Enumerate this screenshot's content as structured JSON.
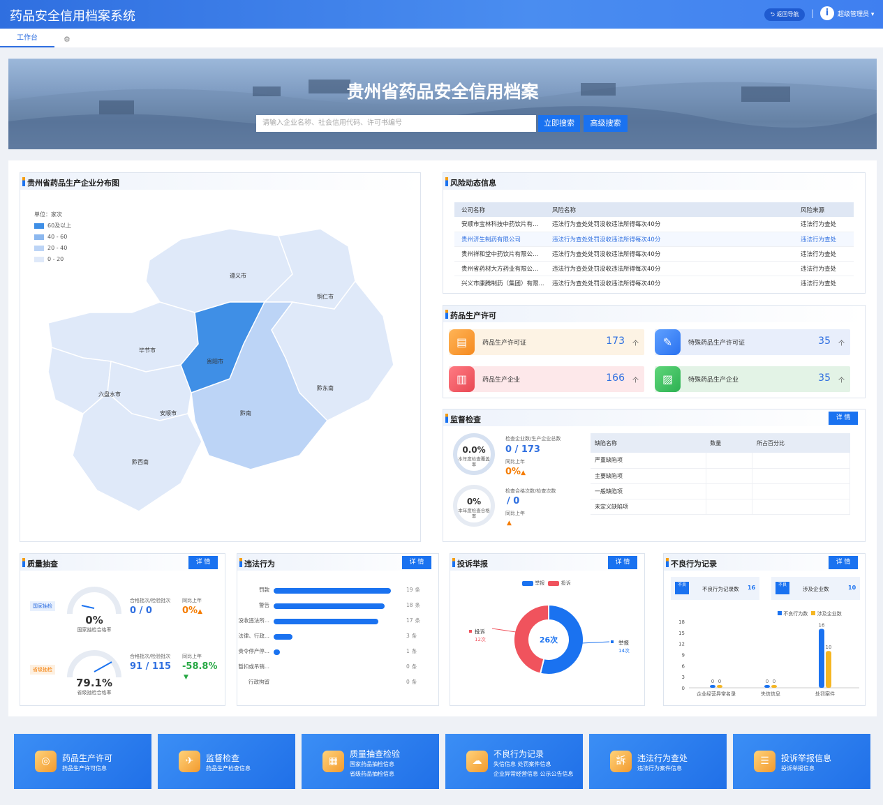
{
  "header": {
    "title": "药品安全信用档案系统",
    "back_label": "返回导航",
    "user_label": "超级管理员",
    "avatar_glyph": "i"
  },
  "tabs": {
    "workbench": "工作台"
  },
  "banner": {
    "title": "贵州省药品安全信用档案",
    "placeholder": "请输入企业名称、社会信用代码、许可书编号",
    "search_btn": "立即搜索",
    "adv_btn": "高级搜索"
  },
  "map": {
    "title": "贵州省药品生产企业分布图",
    "unit": "单位：家次",
    "legend": [
      "60及以上",
      "40 - 60",
      "20 - 40",
      "0 - 20"
    ],
    "legend_colors": [
      "#3f8fe6",
      "#8cb8ef",
      "#bcd4f6",
      "#dfe9f9"
    ],
    "cities": [
      "遵义市",
      "铜仁市",
      "毕节市",
      "贵阳市",
      "黔东南",
      "六盘水市",
      "安顺市",
      "黔南",
      "黔西南"
    ]
  },
  "risk": {
    "title": "风险动态信息",
    "cols": [
      "公司名称",
      "风险名称",
      "风险来源"
    ],
    "rows": [
      [
        "安顺市宝林科技中药饮片有...",
        "违法行为查处处罚没收违法所得每次40分",
        "违法行为查处"
      ],
      [
        "贵州济生制药有限公司",
        "违法行为查处处罚没收违法所得每次40分",
        "违法行为查处"
      ],
      [
        "贵州祥和堂中药饮片有限公...",
        "违法行为查处处罚没收违法所得每次40分",
        "违法行为查处"
      ],
      [
        "贵州省药材大方药业有限公...",
        "违法行为查处处罚没收违法所得每次40分",
        "违法行为查处"
      ],
      [
        "兴义市康腾制药（集团）有限...",
        "违法行为查处处罚没收违法所得每次40分",
        "违法行为查处"
      ]
    ]
  },
  "license": {
    "title": "药品生产许可",
    "unit": "个",
    "cards": [
      {
        "label": "药品生产许可证",
        "value": "173"
      },
      {
        "label": "特殊药品生产许可证",
        "value": "35"
      },
      {
        "label": "药品生产企业",
        "value": "166"
      },
      {
        "label": "特殊药品生产企业",
        "value": "35"
      }
    ]
  },
  "inspect": {
    "title": "监督检查",
    "detail": "详 情",
    "ring1_value": "0.0%",
    "ring1_sub": "本年度检查覆盖率",
    "label1": "检查企业数/生产企业总数",
    "value1": "0 / 173",
    "yoy": "同比上年",
    "yoy1": "0%",
    "ring2_value": "0%",
    "ring2_sub": "本年度检查合格率",
    "label2": "检查合格次数/检查次数",
    "value2": "/ 0",
    "yoy2": "",
    "cols": [
      "缺陷名称",
      "数量",
      "所占百分比"
    ],
    "rows": [
      "严重缺陷项",
      "主要缺陷项",
      "一般缺陷项",
      "未定义缺陷项"
    ]
  },
  "quality": {
    "title": "质量抽查",
    "detail": "详 情",
    "national": {
      "tag": "国家抽检",
      "pct": "0%",
      "caption": "国家抽检合格率",
      "label": "合格批次/检验批次",
      "value": "0 / 0",
      "yoy_label": "同比上年",
      "yoy": "0%"
    },
    "province": {
      "tag": "省级抽检",
      "pct": "79.1%",
      "caption": "省级抽检合格率",
      "label": "合格批次/检验批次",
      "value": "91 / 115",
      "yoy_label": "同比上年",
      "yoy": "-58.8%"
    }
  },
  "illegal": {
    "title": "违法行为",
    "detail": "详 情",
    "unit": "条",
    "chart_data": {
      "type": "bar",
      "categories": [
        "罚款",
        "警告",
        "没收违法所...",
        "法律、行政...",
        "责令停产停...",
        "暂扣或吊销...",
        "行政拘留"
      ],
      "values": [
        19,
        18,
        17,
        3,
        1,
        0,
        0
      ],
      "xlim": [
        0,
        19
      ]
    }
  },
  "complaint": {
    "title": "投诉举报",
    "detail": "详 情",
    "center": "26次",
    "chart_data": {
      "type": "pie",
      "series": [
        {
          "name": "举报",
          "value": 14,
          "color": "#1a72f0"
        },
        {
          "name": "投诉",
          "value": 12,
          "color": "#f0535d"
        }
      ],
      "labels": [
        "举报",
        "14次",
        "投诉",
        "12次"
      ]
    }
  },
  "bad": {
    "title": "不良行为记录",
    "detail": "详 情",
    "stat1_label": "不良行为记录数",
    "stat1_value": "16",
    "stat2_label": "涉及企业数",
    "stat2_value": "10",
    "icon_text": "不良",
    "chart_data": {
      "type": "bar",
      "categories": [
        "企业经营异常名录",
        "失信信息",
        "处罚案件"
      ],
      "series": [
        {
          "name": "不良行为数",
          "values": [
            0,
            0,
            16
          ],
          "color": "#1a72f0"
        },
        {
          "name": "涉及企业数",
          "values": [
            0,
            0,
            10
          ],
          "color": "#f5b623"
        }
      ],
      "ylim": [
        0,
        18
      ],
      "yticks": [
        "18",
        "15",
        "12",
        "9",
        "6",
        "3",
        "0"
      ]
    }
  },
  "footer": [
    {
      "title": "药品生产许可",
      "lines": [
        "药品生产许可信息"
      ]
    },
    {
      "title": "监督检查",
      "lines": [
        "药品生产检查信息"
      ]
    },
    {
      "title": "质量抽查检验",
      "lines": [
        "国家药品抽检信息",
        "省级药品抽检信息"
      ]
    },
    {
      "title": "不良行为记录",
      "lines": [
        "失信信息  处罚案件信息",
        "企业异常经营信息  公示公告信息"
      ]
    },
    {
      "title": "违法行为查处",
      "lines": [
        "违法行为案件信息"
      ]
    },
    {
      "title": "投诉举报信息",
      "lines": [
        "投诉举报信息"
      ]
    }
  ]
}
